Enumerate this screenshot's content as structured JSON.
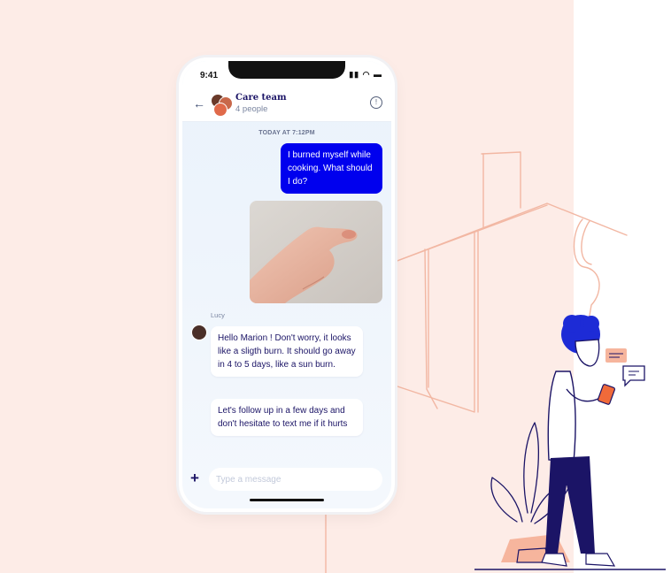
{
  "status_bar": {
    "time": "9:41"
  },
  "conversation": {
    "title": "Care team",
    "subtitle": "4 people"
  },
  "day_stamp": "TODAY AT 7:12PM",
  "messages": [
    {
      "from": "me",
      "text": "I burned myself while cooking.  What should I do?"
    },
    {
      "from": "me",
      "type": "photo",
      "subject": "burned thumb"
    },
    {
      "from": "Lucy",
      "sender_label": "Lucy",
      "text": "Hello Marion ! Don't worry, it looks like a sligth burn. It should go away in 4 to 5 days, like a sun burn."
    },
    {
      "from": "Lucy",
      "text": "Let's follow up in a few days and don't hesitate to text me if it hurts"
    }
  ],
  "composer": {
    "placeholder": "Type a message"
  },
  "colors": {
    "background_pink": "#fdece7",
    "accent_blue": "#0000ee",
    "navy": "#1b1466",
    "sketch_line": "#f2b7a3"
  }
}
